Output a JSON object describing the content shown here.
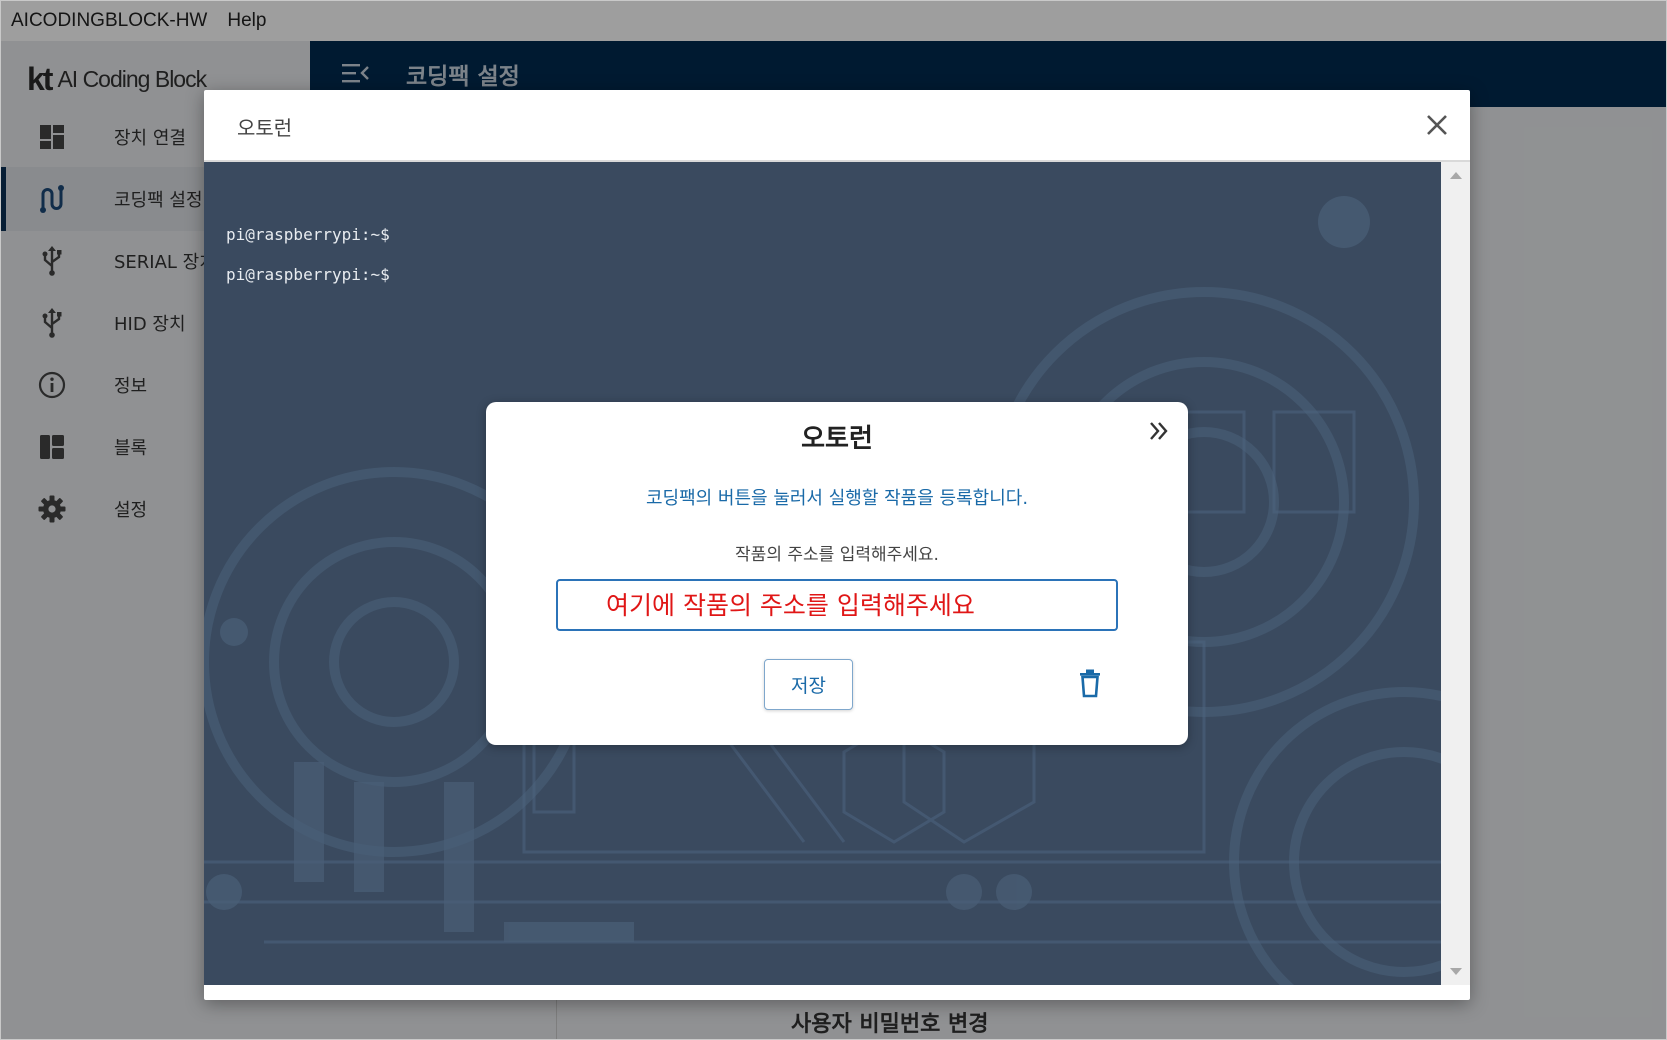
{
  "app": {
    "menu": [
      {
        "label": "AICODINGBLOCK-HW"
      },
      {
        "label": "Help"
      }
    ]
  },
  "sidebar": {
    "logo_kt": "kt",
    "logo_name": "AI Coding Block",
    "items": [
      {
        "label": "장치 연결",
        "icon": "dashboard-icon"
      },
      {
        "label": "코딩팩 설정",
        "icon": "route-icon",
        "active": true
      },
      {
        "label": "SERIAL 장치",
        "icon": "usb-icon"
      },
      {
        "label": "HID 장치",
        "icon": "usb-icon"
      },
      {
        "label": "정보",
        "icon": "info-icon"
      },
      {
        "label": "블록",
        "icon": "blocks-icon"
      },
      {
        "label": "설정",
        "icon": "gear-icon"
      }
    ]
  },
  "header": {
    "title": "코딩팩 설정"
  },
  "main": {
    "bottom_title": "사용자 비밀번호 변경"
  },
  "dialog": {
    "title": "오토런",
    "terminal_lines": [
      "pi@raspberrypi:~$",
      "pi@raspberrypi:~$"
    ]
  },
  "popup": {
    "title": "오토런",
    "description": "코딩팩의 버튼을 눌러서 실행할 작품을 등록합니다.",
    "instruction": "작품의 주소를 입력해주세요.",
    "input_placeholder": "여기에 작품의 주소를 입력해주세요",
    "save_label": "저장"
  },
  "colors": {
    "header_bg": "#002b4f",
    "accent_blue": "#1a6aa8",
    "placeholder_red": "#e01616",
    "terminal_bg": "#3a4a5f"
  }
}
